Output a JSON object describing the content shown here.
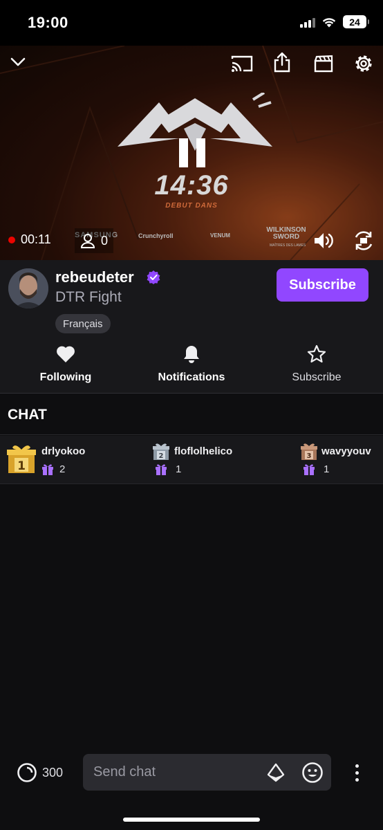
{
  "status_bar": {
    "time": "19:00",
    "battery": "24"
  },
  "player": {
    "countdown": "14:36",
    "countdown_caption": "DEBUT DANS",
    "elapsed": "00:11",
    "viewer_count": "0",
    "sponsors": [
      "SAMSUNG",
      "Crunchyroll",
      "VENUM",
      "WILKINSON SWORD",
      "MAÎTRES DES LAMES"
    ]
  },
  "channel": {
    "name": "rebeudeter",
    "title": "DTR Fight",
    "tag": "Français",
    "subscribe_label": "Subscribe",
    "accent_color": "#9147ff"
  },
  "actions": [
    {
      "label": "Following",
      "icon": "heart-icon"
    },
    {
      "label": "Notifications",
      "icon": "bell-icon"
    },
    {
      "label": "Subscribe",
      "icon": "star-icon"
    }
  ],
  "chat": {
    "header": "CHAT",
    "leaderboard": [
      {
        "rank": "1",
        "name": "drlyokoo",
        "count": "2"
      },
      {
        "rank": "2",
        "name": "floflolhelico",
        "count": "1"
      },
      {
        "rank": "3",
        "name": "wavyyouv",
        "count": "1"
      }
    ]
  },
  "bottom_bar": {
    "points": "300",
    "input_placeholder": "Send chat"
  }
}
